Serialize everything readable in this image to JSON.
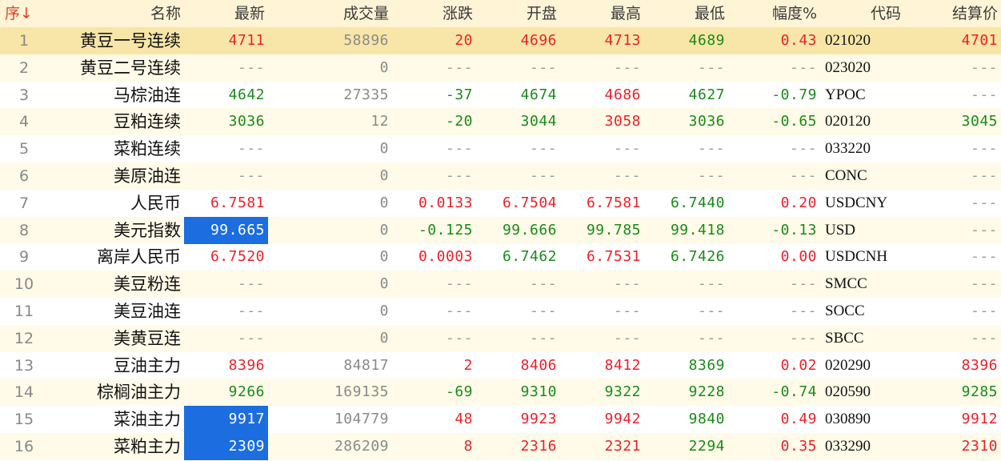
{
  "header": {
    "sort_label": "序↓",
    "columns": [
      "名称",
      "最新",
      "成交量",
      "涨跌",
      "开盘",
      "最高",
      "最低",
      "幅度%",
      "代码",
      "结算价"
    ]
  },
  "rows": [
    {
      "idx": "1",
      "name": "黄豆一号连续",
      "latest": "4711",
      "volume": "58896",
      "change": "20",
      "open": "4696",
      "high": "4713",
      "low": "4689",
      "range": "0.43",
      "code": "021020",
      "settle": "4701"
    },
    {
      "idx": "2",
      "name": "黄豆二号连续",
      "latest": "---",
      "volume": "0",
      "change": "---",
      "open": "---",
      "high": "---",
      "low": "---",
      "range": "---",
      "code": "023020",
      "settle": "---"
    },
    {
      "idx": "3",
      "name": "马棕油连",
      "latest": "4642",
      "volume": "27335",
      "change": "-37",
      "open": "4674",
      "high": "4686",
      "low": "4627",
      "range": "-0.79",
      "code": "YPOC",
      "settle": "---"
    },
    {
      "idx": "4",
      "name": "豆粕连续",
      "latest": "3036",
      "volume": "12",
      "change": "-20",
      "open": "3044",
      "high": "3058",
      "low": "3036",
      "range": "-0.65",
      "code": "020120",
      "settle": "3045"
    },
    {
      "idx": "5",
      "name": "菜粕连续",
      "latest": "---",
      "volume": "0",
      "change": "---",
      "open": "---",
      "high": "---",
      "low": "---",
      "range": "---",
      "code": "033220",
      "settle": "---"
    },
    {
      "idx": "6",
      "name": "美原油连",
      "latest": "---",
      "volume": "0",
      "change": "---",
      "open": "---",
      "high": "---",
      "low": "---",
      "range": "---",
      "code": "CONC",
      "settle": "---"
    },
    {
      "idx": "7",
      "name": "人民币",
      "latest": "6.7581",
      "volume": "0",
      "change": "0.0133",
      "open": "6.7504",
      "high": "6.7581",
      "low": "6.7440",
      "range": "0.20",
      "code": "USDCNY",
      "settle": "---"
    },
    {
      "idx": "8",
      "name": "美元指数",
      "latest": "99.665",
      "volume": "0",
      "change": "-0.125",
      "open": "99.666",
      "high": "99.785",
      "low": "99.418",
      "range": "-0.13",
      "code": "USD",
      "settle": "---"
    },
    {
      "idx": "9",
      "name": "离岸人民币",
      "latest": "6.7520",
      "volume": "0",
      "change": "0.0003",
      "open": "6.7462",
      "high": "6.7531",
      "low": "6.7426",
      "range": "0.00",
      "code": "USDCNH",
      "settle": "---"
    },
    {
      "idx": "10",
      "name": "美豆粉连",
      "latest": "---",
      "volume": "0",
      "change": "---",
      "open": "---",
      "high": "---",
      "low": "---",
      "range": "---",
      "code": "SMCC",
      "settle": "---"
    },
    {
      "idx": "11",
      "name": "美豆油连",
      "latest": "---",
      "volume": "0",
      "change": "---",
      "open": "---",
      "high": "---",
      "low": "---",
      "range": "---",
      "code": "SOCC",
      "settle": "---"
    },
    {
      "idx": "12",
      "name": "美黄豆连",
      "latest": "---",
      "volume": "0",
      "change": "---",
      "open": "---",
      "high": "---",
      "low": "---",
      "range": "---",
      "code": "SBCC",
      "settle": "---"
    },
    {
      "idx": "13",
      "name": "豆油主力",
      "latest": "8396",
      "volume": "84817",
      "change": "2",
      "open": "8406",
      "high": "8412",
      "low": "8369",
      "range": "0.02",
      "code": "020290",
      "settle": "8396"
    },
    {
      "idx": "14",
      "name": "棕榈油主力",
      "latest": "9266",
      "volume": "169135",
      "change": "-69",
      "open": "9310",
      "high": "9322",
      "low": "9228",
      "range": "-0.74",
      "code": "020590",
      "settle": "9285"
    },
    {
      "idx": "15",
      "name": "菜油主力",
      "latest": "9917",
      "volume": "104779",
      "change": "48",
      "open": "9923",
      "high": "9942",
      "low": "9840",
      "range": "0.49",
      "code": "030890",
      "settle": "9912"
    },
    {
      "idx": "16",
      "name": "菜粕主力",
      "latest": "2309",
      "volume": "286209",
      "change": "8",
      "open": "2316",
      "high": "2321",
      "low": "2294",
      "range": "0.35",
      "code": "033290",
      "settle": "2310"
    }
  ],
  "colors": {
    "up": "#e8222a",
    "down": "#1a8a1a",
    "neutral": "#8a8a8a",
    "highlight": "#1b6de0",
    "selected_row": "#f8e6a8",
    "header_bg": "#fff4d6"
  }
}
